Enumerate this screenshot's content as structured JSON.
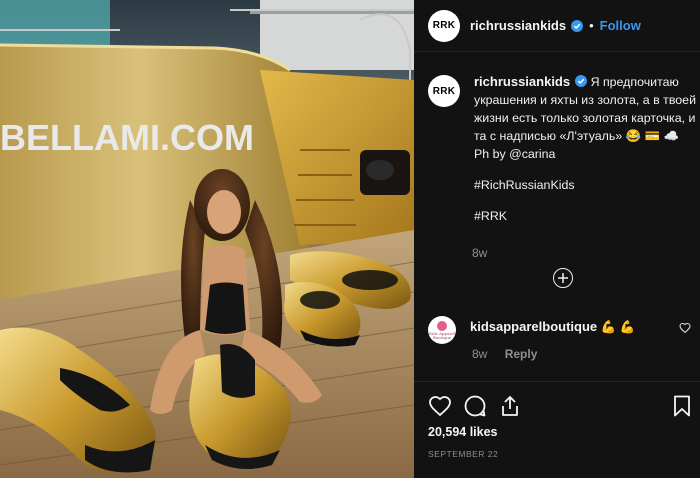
{
  "post": {
    "image_alt": "Woman posing on gold yacht deck with gold sea scooters",
    "yacht_name": "BELLAMI.COM",
    "colors": {
      "gold": "#c9a23a",
      "deck": "#a07d52",
      "accent": "#3897f0"
    }
  },
  "header": {
    "avatar_text": "RRK",
    "username": "richrussiankids",
    "verified_icon": "verified-badge-icon",
    "separator": "•",
    "follow_label": "Follow"
  },
  "caption": {
    "avatar_text": "RRK",
    "username": "richrussiankids",
    "lines": [
      "Я предпочитаю",
      "украшения и яхты из золота, а в твоей",
      "жизни есть только золотая карточка, и",
      "та с надписью «Л'этуаль» 😂 💳 ☁️",
      "Ph by @carina"
    ],
    "hashtag1": "#RichRussianKids",
    "hashtag2": "#RRK",
    "time": "8w"
  },
  "load_more_icon": "plus-circle-icon",
  "comment": {
    "avatar_line1": "Kids Apparel",
    "avatar_line2": "Boutique",
    "username": "kidsapparelboutique",
    "text": "💪 💪",
    "time": "8w",
    "reply_label": "Reply",
    "like_icon": "heart-outline-icon"
  },
  "actions": {
    "icons": [
      "heart-icon",
      "comment-icon",
      "share-icon",
      "bookmark-icon"
    ],
    "likes": "20,594 likes",
    "date": "SEPTEMBER 22"
  }
}
